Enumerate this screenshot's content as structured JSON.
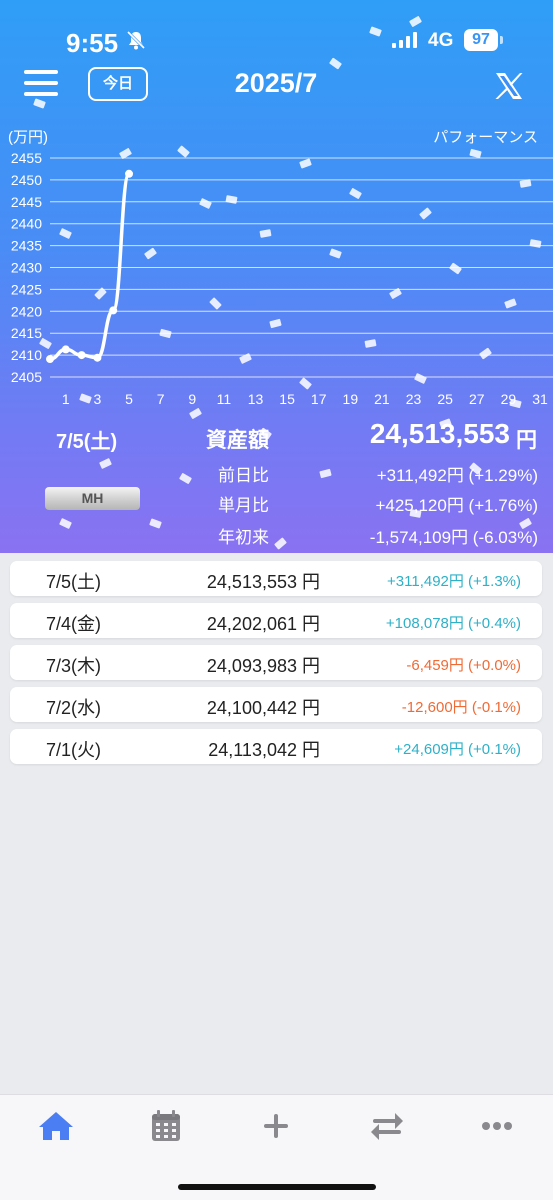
{
  "status_bar": {
    "time": "9:55",
    "network": "4G",
    "battery": "97"
  },
  "header": {
    "today_button": "今日",
    "month_title": "2025/7"
  },
  "chart_data": {
    "type": "line",
    "title": "パフォーマンス",
    "ylabel": "(万円)",
    "ylim": [
      2405,
      2455
    ],
    "yticks": [
      2405,
      2410,
      2415,
      2420,
      2425,
      2430,
      2435,
      2440,
      2445,
      2450,
      2455
    ],
    "xlim": [
      0,
      31
    ],
    "xticks": [
      1,
      3,
      5,
      7,
      9,
      11,
      13,
      15,
      17,
      19,
      21,
      23,
      25,
      27,
      29,
      31
    ],
    "series": [
      {
        "x": [
          0,
          1,
          2,
          3,
          4,
          5
        ],
        "values": [
          2409.1,
          2411.3,
          2410.0,
          2409.4,
          2420.2,
          2451.4
        ]
      }
    ],
    "grid": true
  },
  "summary": {
    "date": "7/5(土)",
    "label": "資産額",
    "value": "24,513,553",
    "unit": "円",
    "badge": "MH",
    "comparisons": [
      {
        "label": "前日比",
        "value": "+311,492円 (+1.29%)"
      },
      {
        "label": "単月比",
        "value": "+425,120円 (+1.76%)"
      },
      {
        "label": "年初来",
        "value": "-1,574,109円 (-6.03%)"
      }
    ]
  },
  "daily_list": [
    {
      "date": "7/5(土)",
      "amount": "24,513,553 円",
      "change": "+311,492円 (+1.3%)",
      "trend": "up"
    },
    {
      "date": "7/4(金)",
      "amount": "24,202,061 円",
      "change": "+108,078円 (+0.4%)",
      "trend": "up"
    },
    {
      "date": "7/3(木)",
      "amount": "24,093,983 円",
      "change": "-6,459円 (+0.0%)",
      "trend": "down"
    },
    {
      "date": "7/2(水)",
      "amount": "24,100,442 円",
      "change": "-12,600円 (-0.1%)",
      "trend": "down"
    },
    {
      "date": "7/1(火)",
      "amount": "24,113,042 円",
      "change": "+24,609円 (+0.1%)",
      "trend": "up"
    }
  ],
  "tab_bar": {
    "items": [
      {
        "icon": "home-icon",
        "active": true
      },
      {
        "icon": "calendar-icon",
        "active": false
      },
      {
        "icon": "plus-icon",
        "active": false
      },
      {
        "icon": "transfer-icon",
        "active": false
      },
      {
        "icon": "more-icon",
        "active": false
      }
    ],
    "active_color": "#4a7ef2",
    "inactive_color": "#8a8a8e"
  },
  "colors": {
    "positive": "#2eb0c7",
    "negative": "#f06a35"
  }
}
